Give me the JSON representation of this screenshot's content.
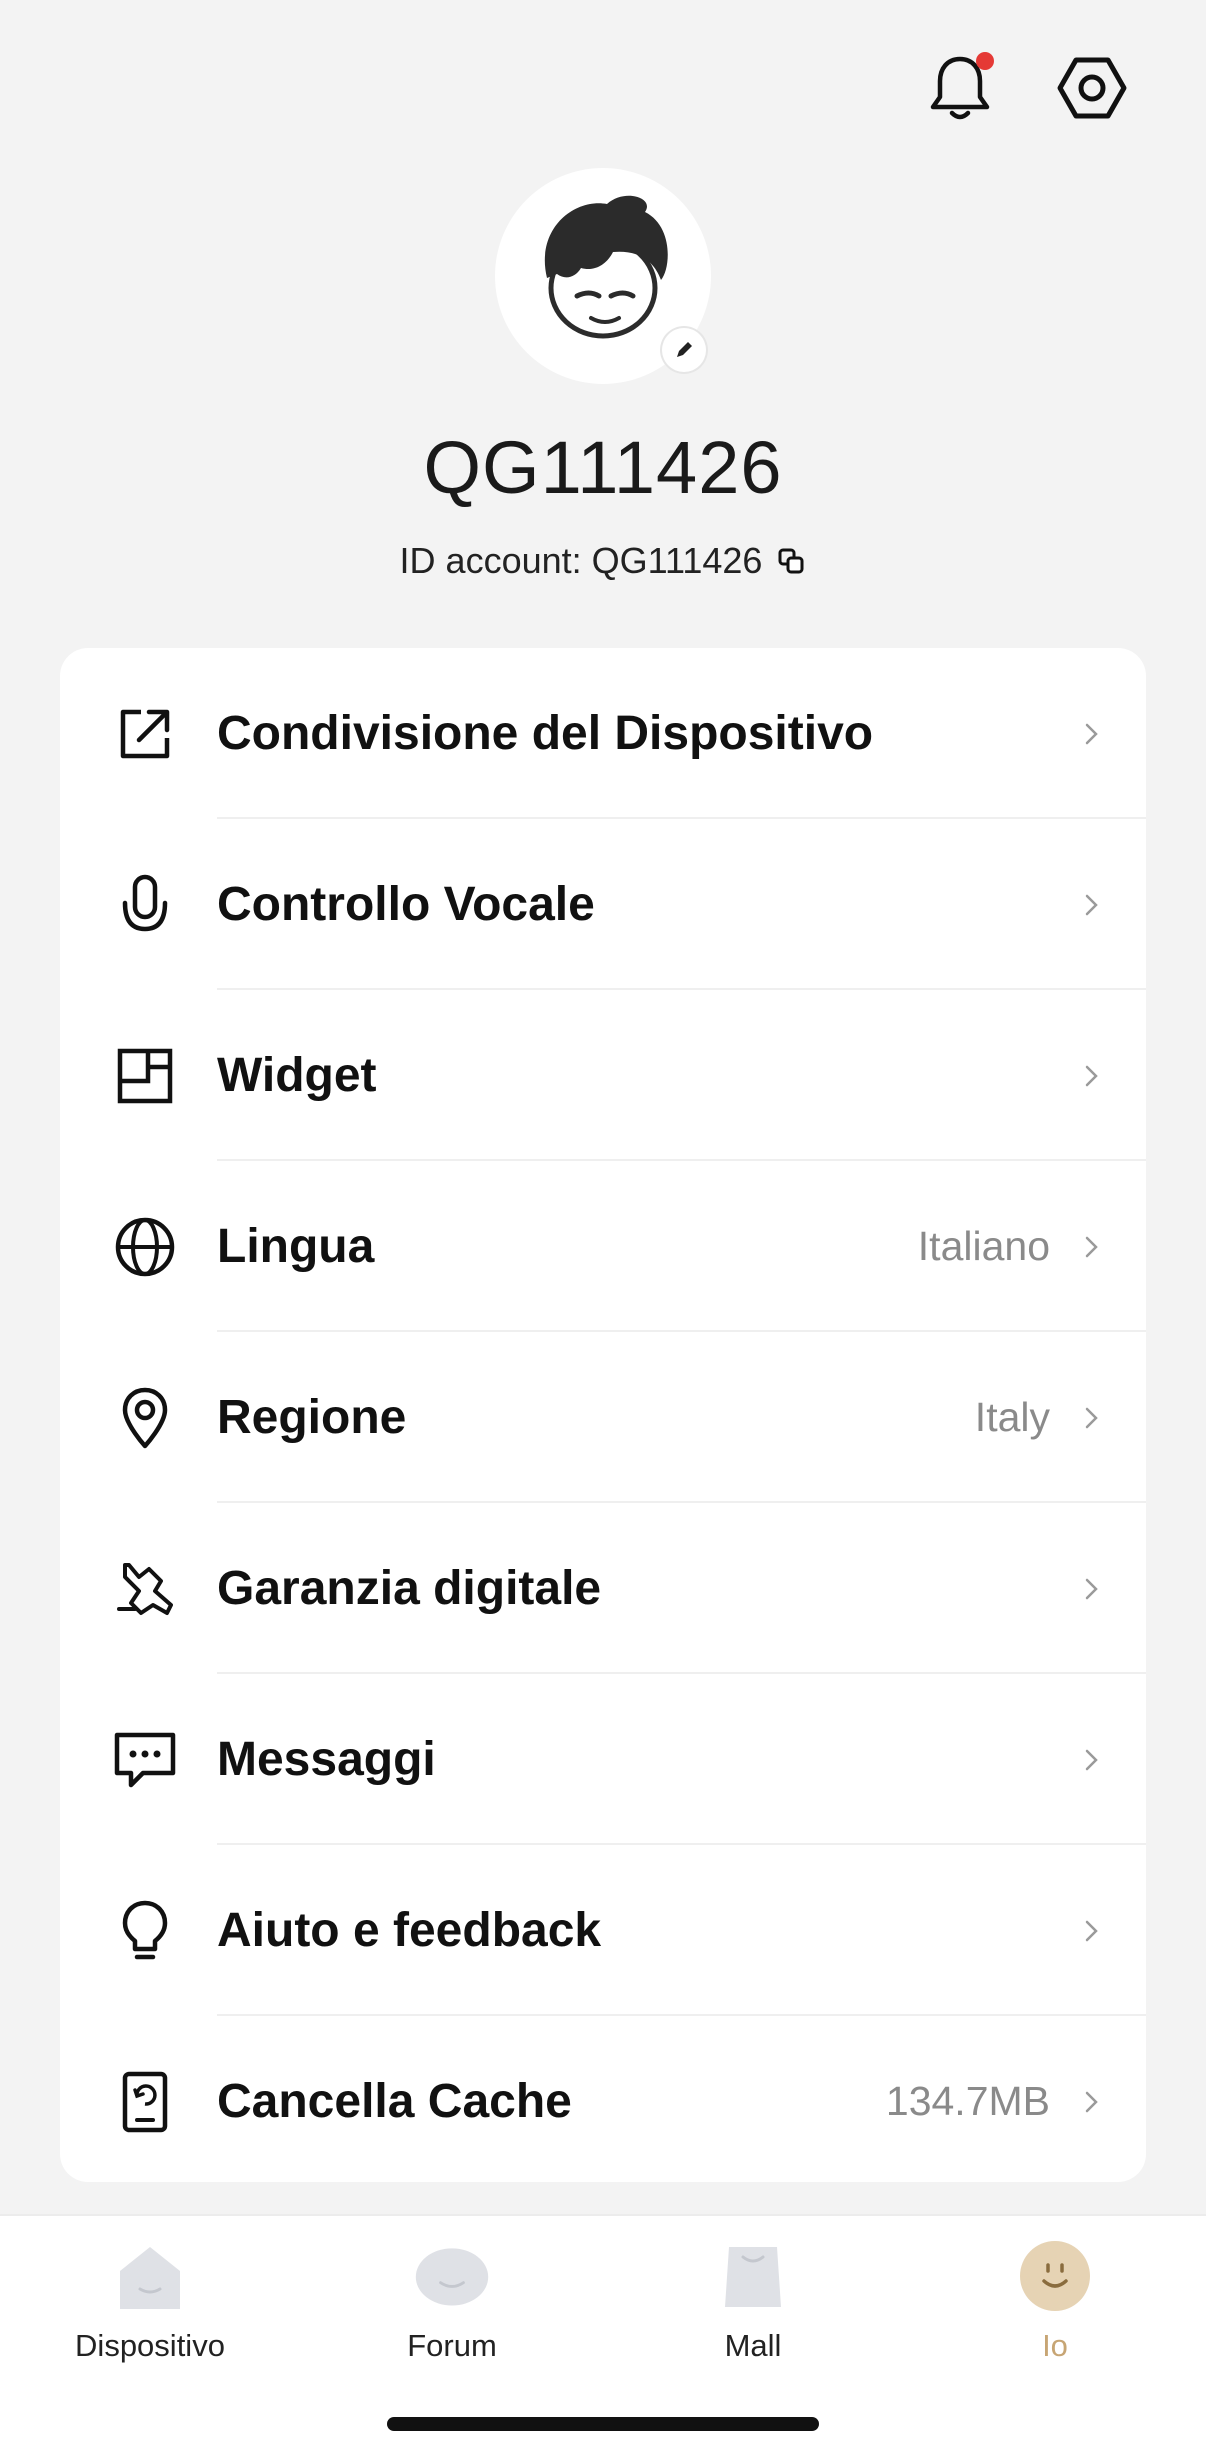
{
  "header": {
    "notifications_has_unread": true,
    "icons": [
      "bell-icon",
      "settings-gear-icon"
    ]
  },
  "profile": {
    "username": "QG111426",
    "account_id_label": "ID account: QG111426",
    "avatar_icon": "cartoon-avatar-icon",
    "edit_icon": "pencil-icon",
    "copy_icon": "copy-icon"
  },
  "menu": {
    "items": [
      {
        "label": "Condivisione del Dispositivo",
        "value": "",
        "icon": "share-external-icon"
      },
      {
        "label": "Controllo Vocale",
        "value": "",
        "icon": "microphone-icon"
      },
      {
        "label": "Widget",
        "value": "",
        "icon": "widget-icon"
      },
      {
        "label": "Lingua",
        "value": "Italiano",
        "icon": "globe-icon"
      },
      {
        "label": "Regione",
        "value": "Italy",
        "icon": "location-pin-icon"
      },
      {
        "label": "Garanzia digitale",
        "value": "",
        "icon": "wrench-icon"
      },
      {
        "label": "Messaggi",
        "value": "",
        "icon": "message-bubble-icon"
      },
      {
        "label": "Aiuto e feedback",
        "value": "",
        "icon": "lightbulb-icon"
      },
      {
        "label": "Cancella Cache",
        "value": "134.7MB",
        "icon": "cache-phone-icon"
      }
    ]
  },
  "tabbar": {
    "tabs": [
      {
        "label": "Dispositivo",
        "icon": "home-icon",
        "active": false
      },
      {
        "label": "Forum",
        "icon": "forum-icon",
        "active": false
      },
      {
        "label": "Mall",
        "icon": "shopping-bag-icon",
        "active": false
      },
      {
        "label": "Io",
        "icon": "profile-smile-icon",
        "active": true
      }
    ]
  },
  "colors": {
    "background": "#f3f3f3",
    "card": "#ffffff",
    "accent_gold": "#c7a574",
    "notification_dot": "#e53935"
  }
}
